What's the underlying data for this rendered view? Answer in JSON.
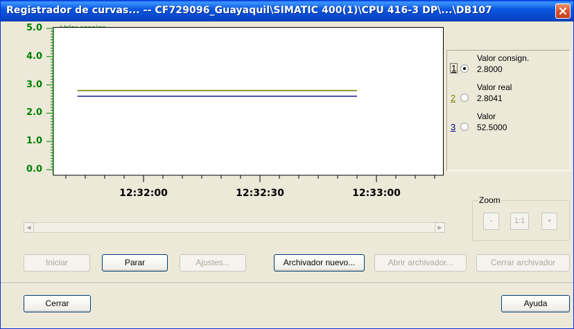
{
  "window": {
    "title": "Registrador de curvas... -- CF729096_Guayaquil\\SIMATIC 400(1)\\CPU 416-3 DP\\...\\DB107"
  },
  "chart": {
    "title": "Valor consign."
  },
  "chart_data": {
    "type": "line",
    "title": "Valor consign.",
    "y_ticks": [
      "5.0",
      "4.0",
      "3.0",
      "2.0",
      "1.0",
      "0.0"
    ],
    "ylim": [
      0,
      5
    ],
    "x_ticks": [
      "12:32:00",
      "12:32:30",
      "12:33:00"
    ],
    "series": [
      {
        "name": "Valor consign.",
        "color": "#008000",
        "x_start": "12:31:43",
        "x_end": "12:32:55",
        "values": [
          2.8,
          2.8
        ]
      },
      {
        "name": "Valor real",
        "color": "#808000",
        "x_start": "12:31:43",
        "x_end": "12:32:55",
        "values": [
          2.8041,
          2.8041
        ]
      },
      {
        "name": "Valor",
        "color": "#000080",
        "x_start": "12:31:43",
        "x_end": "12:32:55",
        "values": [
          2.6,
          2.6
        ]
      }
    ],
    "grid": false
  },
  "legend": {
    "items": [
      {
        "num": "1",
        "name": "Valor consign.",
        "value": "2.8000",
        "selected": true,
        "color": "#000000"
      },
      {
        "num": "2",
        "name": "Valor real",
        "value": "2.8041",
        "selected": false,
        "color": "#808000"
      },
      {
        "num": "3",
        "name": "Valor",
        "value": "52.5000",
        "selected": false,
        "color": "#000080"
      }
    ]
  },
  "zoom": {
    "label": "Zoom",
    "minus": "-",
    "reset": "1:1",
    "plus": "+"
  },
  "buttons": {
    "iniciar": "Iniciar",
    "parar": "Parar",
    "ajustes": "Ajustes...",
    "archivador_nuevo": "Archivador nuevo...",
    "abrir_archivador": "Abrir archivador...",
    "cerrar_archivador": "Cerrar archivador",
    "cerrar": "Cerrar",
    "ayuda": "Ayuda"
  },
  "icons": {
    "close": "close-icon",
    "scroll_left": "arrow-left-icon",
    "scroll_right": "arrow-right-icon"
  }
}
